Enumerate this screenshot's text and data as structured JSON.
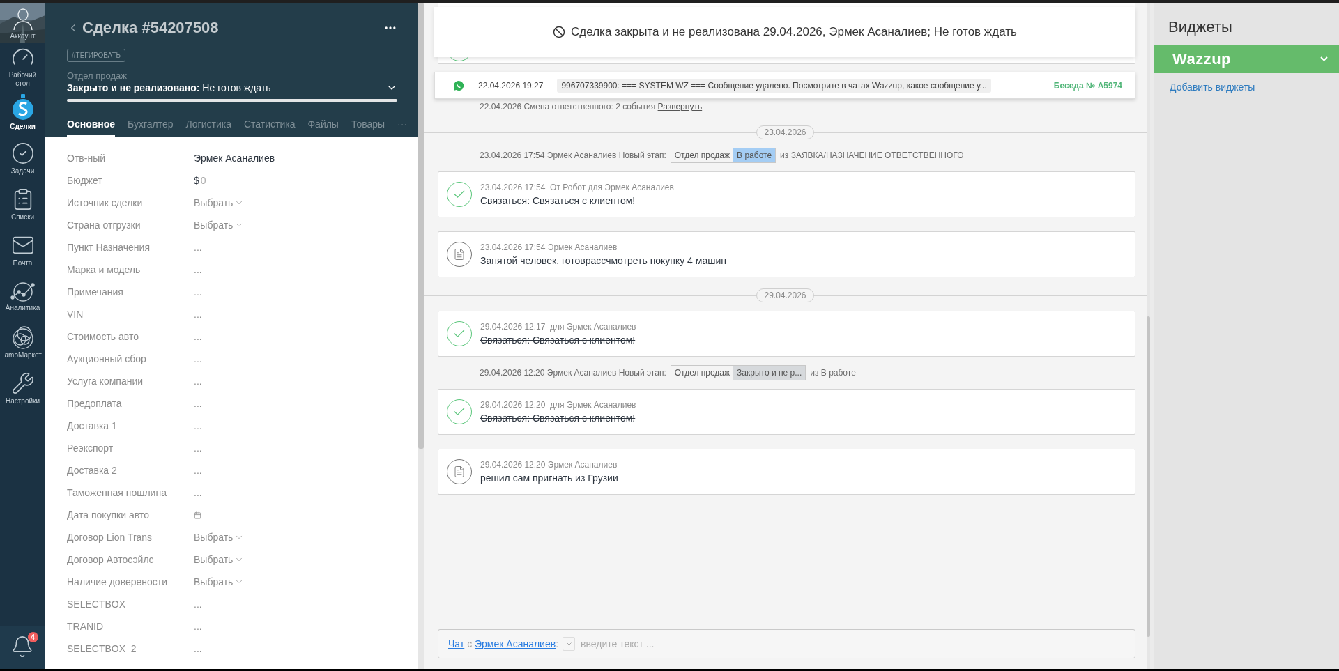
{
  "nav": {
    "items": [
      {
        "label": "Аккаунт",
        "selected": false
      },
      {
        "label": "Рабочий стол",
        "selected": false
      },
      {
        "label": "Сделки",
        "selected": true
      },
      {
        "label": "Задачи",
        "selected": false
      },
      {
        "label": "Списки",
        "selected": false
      },
      {
        "label": "Почта",
        "selected": false
      },
      {
        "label": "Аналитика",
        "selected": false
      },
      {
        "label": "amoМаркет",
        "selected": false
      },
      {
        "label": "Настройки",
        "selected": false
      }
    ],
    "notifications": {
      "count": "4"
    }
  },
  "deal": {
    "title": "Сделка #54207508",
    "tag_button": "#ТЕГИРОВАТЬ",
    "pipeline": "Отдел продаж",
    "status": "**Закрыто и не реализовано:** Не готов ждать",
    "progress": {
      "level": 1
    },
    "tabs": [
      {
        "label": "Основное",
        "selected": true
      },
      {
        "label": "Бухгалтер",
        "selected": false
      },
      {
        "label": "Логистика",
        "selected": false
      },
      {
        "label": "Статистика",
        "selected": false
      },
      {
        "label": "Файлы",
        "selected": false
      },
      {
        "label": "Товары",
        "selected": false
      },
      {
        "label": "···",
        "selected": false
      }
    ],
    "fields": [
      {
        "label": "Отв-ный",
        "kind": "text",
        "value": "Эрмек Асаналиев"
      },
      {
        "label": "Бюджет",
        "kind": "money",
        "currency": "$",
        "value": "0"
      },
      {
        "label": "Источник сделки",
        "kind": "select",
        "value": "Выбрать"
      },
      {
        "label": "Страна отгрузки",
        "kind": "select",
        "value": "Выбрать"
      },
      {
        "label": "Пункт Назначения",
        "kind": "empty",
        "value": "..."
      },
      {
        "label": "Марка и модель",
        "kind": "empty",
        "value": "..."
      },
      {
        "label": "Примечания",
        "kind": "empty",
        "value": "..."
      },
      {
        "label": "VIN",
        "kind": "empty",
        "value": "..."
      },
      {
        "label": "Стоимость авто",
        "kind": "empty",
        "value": "..."
      },
      {
        "label": "Аукционный сбор",
        "kind": "empty",
        "value": "..."
      },
      {
        "label": "Услуга компании",
        "kind": "empty",
        "value": "..."
      },
      {
        "label": "Предоплата",
        "kind": "empty",
        "value": "..."
      },
      {
        "label": "Доставка 1",
        "kind": "empty",
        "value": "..."
      },
      {
        "label": "Реэкспорт",
        "kind": "empty",
        "value": "..."
      },
      {
        "label": "Доставка 2",
        "kind": "empty",
        "value": "..."
      },
      {
        "label": "Таможенная пошлина",
        "kind": "empty",
        "value": "..."
      },
      {
        "label": "Дата покупки авто",
        "kind": "date"
      },
      {
        "label": "Договор Lion Trans",
        "kind": "select",
        "value": "Выбрать"
      },
      {
        "label": "Договор Автосэйлс",
        "kind": "select",
        "value": "Выбрать"
      },
      {
        "label": "Наличие доверености",
        "kind": "select",
        "value": "Выбрать"
      },
      {
        "label": "SELECTBOX",
        "kind": "empty",
        "value": "..."
      },
      {
        "label": "TRANID",
        "kind": "empty",
        "value": "..."
      },
      {
        "label": "SELECTBOX_2",
        "kind": "empty",
        "value": "..."
      }
    ]
  },
  "banner": {
    "text": "Сделка закрыта и не реализована 29.04.2026, Эрмек Асаналиев; Не готов ждать"
  },
  "chat_notice": {
    "time": "22.04.2026 19:27",
    "message": "996707339900: === SYSTEM WZ === Сообщение удалено. Посмотрите в чатах Wazzup, какое сообщение у...",
    "conversation": "Беседа № A5974"
  },
  "feed": [
    {
      "kind": "partial"
    },
    {
      "kind": "event",
      "text": "22.04.2026 Смена ответственного: 2 события",
      "link": "Развернуть"
    },
    {
      "kind": "date",
      "text": "23.04.2026"
    },
    {
      "kind": "stage",
      "text": "23.04.2026 17:54 Эрмек Асаналиев Новый этап:",
      "pipeline": "Отдел продаж",
      "stage": "В работе",
      "color": "#a4cdf4",
      "from": "из ЗАЯВКА/НАЗНАЧЕНИЕ ОТВЕТСТВЕННОГО"
    },
    {
      "kind": "task",
      "meta": "23.04.2026 17:54  От Робот для Эрмек Асаналиев",
      "text": "Связаться: Связаться с клиентом!",
      "done": true
    },
    {
      "kind": "note",
      "meta": "23.04.2026 17:54 Эрмек Асаналиев",
      "text": "Занятой человек, готоврассчмотреть покупку 4 машин"
    },
    {
      "kind": "date",
      "text": "29.04.2026"
    },
    {
      "kind": "task",
      "meta": "29.04.2026 12:17  для Эрмек Асаналиев",
      "text": "Связаться: Связаться с клиентом!",
      "done": true
    },
    {
      "kind": "stage",
      "text": "29.04.2026 12:20 Эрмек Асаналиев Новый этап:",
      "pipeline": "Отдел продаж",
      "stage": "Закрыто и не р...",
      "color": "#d6d9dc",
      "from": "из В работе"
    },
    {
      "kind": "task",
      "meta": "29.04.2026 12:20  для Эрмек Асаналиев",
      "text": "Связаться: Связаться с клиентом!",
      "done": true
    },
    {
      "kind": "note",
      "meta": "29.04.2026 12:20 Эрмек Асаналиев",
      "text": "решил сам пригнать из Грузии"
    }
  ],
  "chat": {
    "link": "Чат",
    "joiner": "с",
    "contact": "Эрмек Асаналиев",
    "colon": ":",
    "placeholder": "введите текст ..."
  },
  "widgets": {
    "title": "Виджеты",
    "items": [
      {
        "name": "Wazzup",
        "expanded": false
      }
    ],
    "add_link": "Добавить виджеты"
  }
}
